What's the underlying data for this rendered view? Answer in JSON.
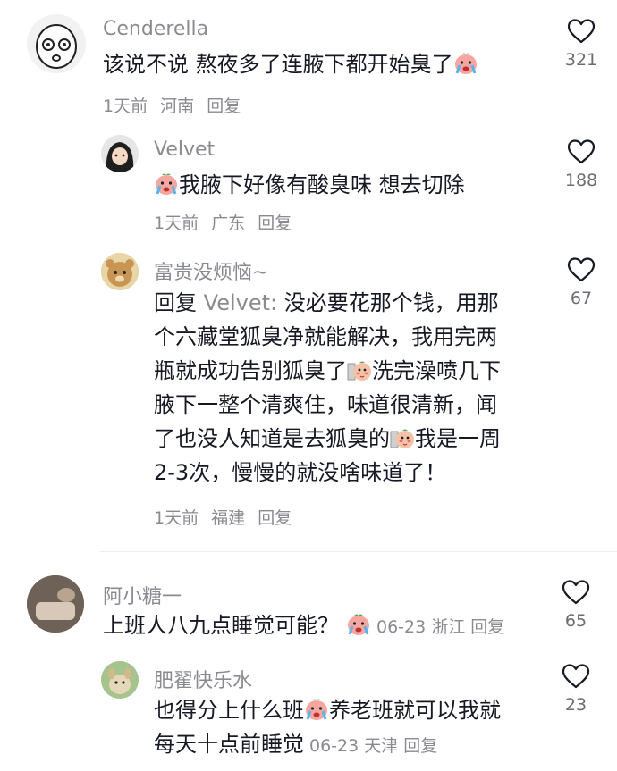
{
  "comments": [
    {
      "author": "Cenderella",
      "text_before": "该说不说 熬夜多了连腋下都开始臭了",
      "time": "1天前",
      "location": "河南",
      "reply_label": "回复",
      "likes": "321"
    },
    {
      "author": "Velvet",
      "text": "我腋下好像有酸臭味 想去切除",
      "time": "1天前",
      "location": "广东",
      "reply_label": "回复",
      "likes": "188"
    },
    {
      "author": "富贵没烦恼~",
      "reply_prefix": "回复",
      "reply_target": "Velvet:",
      "line1": "没必要花那个钱，用那",
      "line2": "个六藏堂狐臭净就能解决，我用完两",
      "line3a": "瓶就成功告别狐臭了",
      "line3b": "洗完澡喷几下",
      "line4": "腋下一整个清爽住，味道很清新，闻",
      "line5a": "了也没人知道是去狐臭的",
      "line5b": "我是一周",
      "line6": "2-3次，慢慢的就没啥味道了！",
      "time": "1天前",
      "location": "福建",
      "reply_label": "回复",
      "likes": "67"
    },
    {
      "author": "阿小糖一",
      "text": "上班人八九点睡觉可能？",
      "time": "06-23",
      "location": "浙江",
      "reply_label": "回复",
      "likes": "65"
    },
    {
      "author": "肥翟快乐水",
      "line1a": "也得分上什么班",
      "line1b": "养老班就可以我就",
      "line2": "每天十点前睡觉",
      "time": "06-23",
      "location": "天津",
      "reply_label": "回复",
      "likes": "23"
    }
  ],
  "icons": {
    "like": "heart-outline-icon",
    "emoji_cry": "crying-face-emoji",
    "emoji_shy": "shy-face-emoji"
  },
  "colors": {
    "text": "#161823",
    "secondary": "#8a8b91",
    "divider": "#eeeeee"
  }
}
